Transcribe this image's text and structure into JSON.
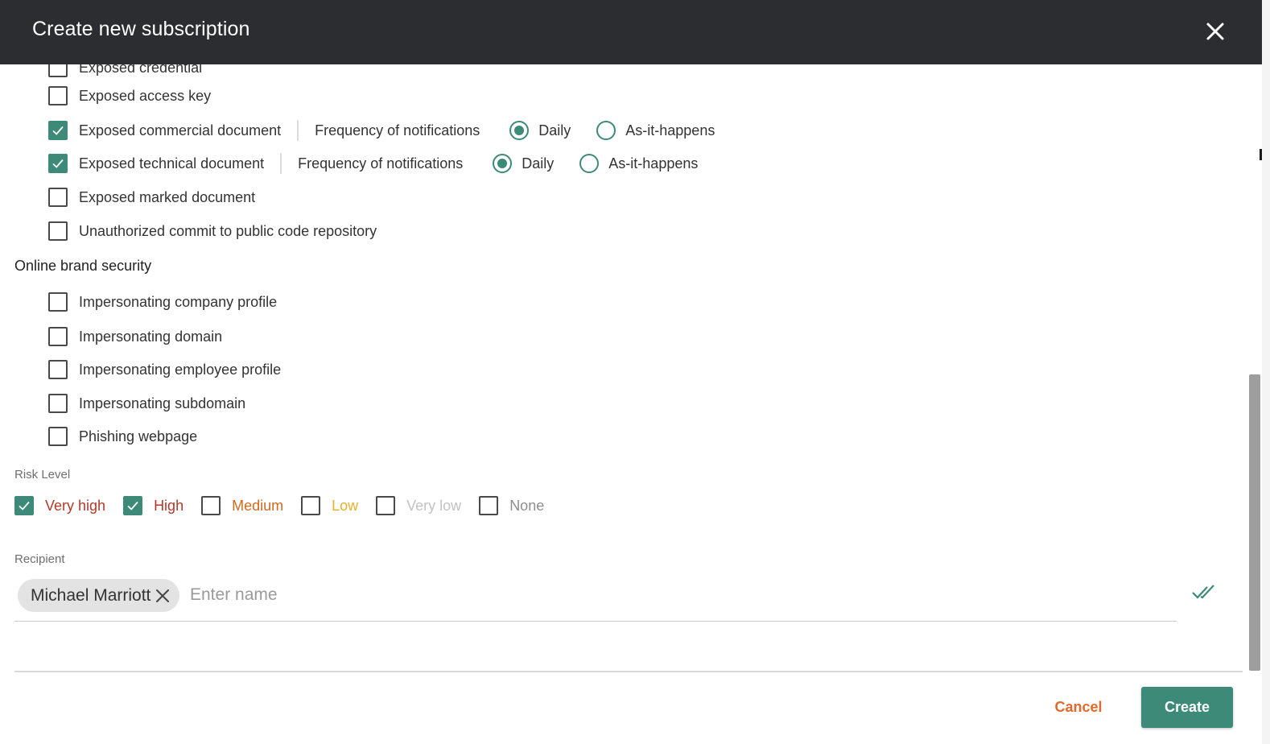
{
  "dialog": {
    "title": "Create new subscription"
  },
  "colors": {
    "accent": "#3d8a78",
    "header_bg": "#2b2d31",
    "cancel": "#e06a2c",
    "risk_very_high": "#b23a2b",
    "risk_high": "#b23a2b",
    "risk_medium": "#d2691e",
    "risk_low": "#e2b32a",
    "risk_very_low": "#c2c2c2",
    "risk_none": "#8e8e8e"
  },
  "icons": {
    "close": "close-icon",
    "check": "check-icon",
    "chip_remove": "close-icon",
    "select_all": "double-check-icon"
  },
  "data_leakage_items": [
    {
      "label": "Exposed credential",
      "checked": false
    },
    {
      "label": "Exposed access key",
      "checked": false
    },
    {
      "label": "Exposed commercial document",
      "checked": true,
      "frequency_label": "Frequency of notifications",
      "options": [
        "Daily",
        "As-it-happens"
      ],
      "selected": "Daily"
    },
    {
      "label": "Exposed technical document",
      "checked": true,
      "frequency_label": "Frequency of notifications",
      "options": [
        "Daily",
        "As-it-happens"
      ],
      "selected": "Daily"
    },
    {
      "label": "Exposed marked document",
      "checked": false
    },
    {
      "label": "Unauthorized commit to public code repository",
      "checked": false
    }
  ],
  "brand_section": {
    "title": "Online brand security",
    "items": [
      {
        "label": "Impersonating company profile",
        "checked": false
      },
      {
        "label": "Impersonating domain",
        "checked": false
      },
      {
        "label": "Impersonating employee profile",
        "checked": false
      },
      {
        "label": "Impersonating subdomain",
        "checked": false
      },
      {
        "label": "Phishing webpage",
        "checked": false
      }
    ]
  },
  "risk": {
    "title": "Risk Level",
    "levels": [
      {
        "label": "Very high",
        "checked": true
      },
      {
        "label": "High",
        "checked": true
      },
      {
        "label": "Medium",
        "checked": false
      },
      {
        "label": "Low",
        "checked": false
      },
      {
        "label": "Very low",
        "checked": false
      },
      {
        "label": "None",
        "checked": false
      }
    ]
  },
  "recipient": {
    "title": "Recipient",
    "chips": [
      "Michael Marriott"
    ],
    "input_value": "",
    "placeholder": "Enter name"
  },
  "footer": {
    "cancel_label": "Cancel",
    "create_label": "Create"
  }
}
